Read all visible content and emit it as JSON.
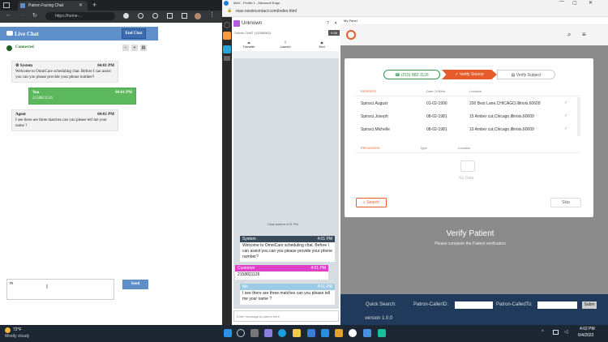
{
  "left_browser": {
    "tab_title": "Patron Facing Chat",
    "url": "https://home-..."
  },
  "chat": {
    "title": "Live Chat",
    "end_button": "End Chat",
    "status": "Connected",
    "messages": [
      {
        "sender": "System",
        "time": "04:01 PM",
        "text": "Welcome to OmniCare scheduling chat. Before I can assist you can you please provide your phone number?"
      },
      {
        "sender": "You",
        "time": "04:01 PM",
        "text": "2158821126"
      },
      {
        "sender": "Agent",
        "time": "04:01 PM",
        "text": "I see there are three matches can you please tell me your name ?"
      }
    ],
    "input_value": "m",
    "send_button": "Send"
  },
  "right_browser": {
    "window_title": "MAX - Profile 1 - Microsoft Edge",
    "url": "max.niceincontact.com/index.html"
  },
  "agent_panel": {
    "contact_name": "Unknown",
    "contact_sub": "Sclinfo CHAT (15308982)",
    "timer": "0:38",
    "actions": [
      "Transfer",
      "Launch",
      "End"
    ],
    "chat_started": "Chat started 4:01 PM",
    "messages": [
      {
        "sender": "System",
        "time": "4:01 PM",
        "text": "Welcome to OmniCare scheduling chat. Before I can assist you can you please provide your phone number?"
      },
      {
        "sender": "Customer",
        "time": "4:01 PM",
        "text": "2158821126"
      },
      {
        "sender": "Me",
        "time": "4:01 PM",
        "text": "I see there are three matches can you please tell me your name ?"
      }
    ],
    "input_placeholder": "Enter message to patron here"
  },
  "my_panel": {
    "header": "My Panel",
    "steps": {
      "phone": "(215) 882-1126",
      "verify_source": "Verify Source",
      "verify_subject": "Verify Subject"
    },
    "patients_header": [
      "PATIENTS",
      "Date Of Birth",
      "Location"
    ],
    "patients": [
      {
        "name": "Spinsci,August",
        "dob": "01-02-1990",
        "location": "200 Best Lane,CHICAGO,Illinois,60609"
      },
      {
        "name": "Spinsci,Joseph",
        "dob": "08-02-1981",
        "location": "15 Amber cut,Chicago,Illinois,60609"
      },
      {
        "name": "Spinsci,Michelle",
        "dob": "08-02-1981",
        "location": "10 Amber cut,Chicago,Illinois,60609"
      }
    ],
    "providers_header": [
      "PROVIDERS",
      "Type",
      "Location"
    ],
    "no_data": "No Data",
    "search_button": "Search",
    "skip_button": "Skip",
    "verify_title": "Verify Patient",
    "verify_sub": "Please complete the Patient verification",
    "quick_search": "Quick Search:",
    "patron_caller_id": "Patron-CallerID:",
    "patron_called_to": "Patron-CalledTo:",
    "submit": "Subm",
    "version": "version 1.0.0"
  },
  "taskbar": {
    "temp": "72°F",
    "weather": "Mostly cloudy",
    "time": "4:02 PM",
    "date": "6/4/2022"
  },
  "colors": {
    "accent_blue": "#5f8fc9",
    "orange": "#e65c2b",
    "green": "#2e9a4a",
    "you_green": "#5cb85c",
    "customer_pink": "#e040c8",
    "me_blue": "#9ccbe6"
  }
}
